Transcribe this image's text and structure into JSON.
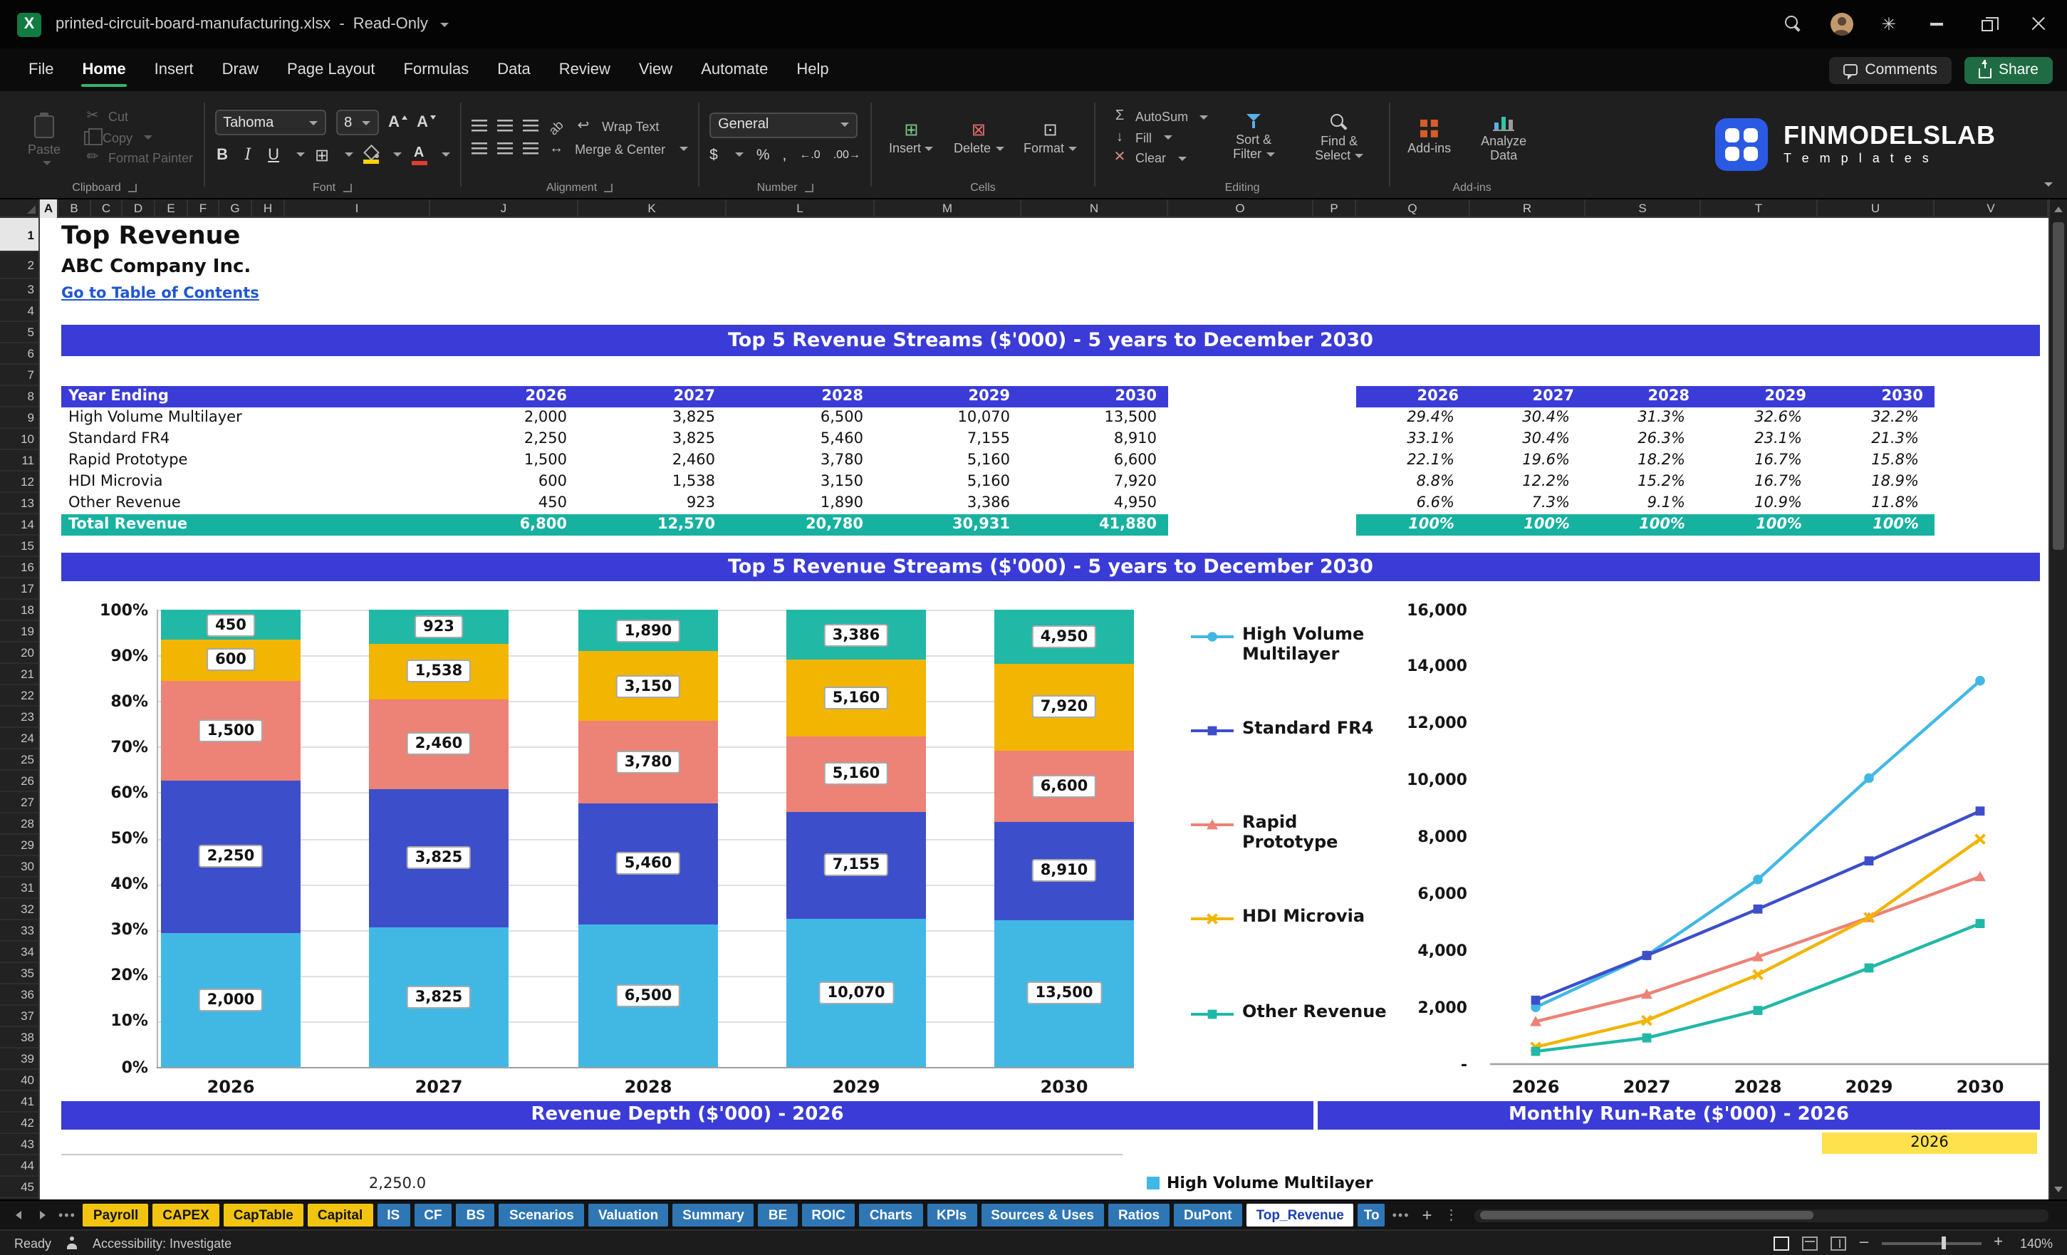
{
  "app": {
    "title": "printed-circuit-board-manufacturing.xlsx",
    "mode": "Read-Only"
  },
  "menubar": {
    "tabs": [
      "File",
      "Home",
      "Insert",
      "Draw",
      "Page Layout",
      "Formulas",
      "Data",
      "Review",
      "View",
      "Automate",
      "Help"
    ],
    "active_tab": "Home",
    "comments_label": "Comments",
    "share_label": "Share"
  },
  "ribbon": {
    "clipboard": {
      "group": "Clipboard",
      "paste": "Paste",
      "cut": "Cut",
      "copy": "Copy",
      "format_painter": "Format Painter"
    },
    "font": {
      "group": "Font",
      "font_name": "Tahoma",
      "font_size": "8"
    },
    "alignment": {
      "group": "Alignment",
      "wrap_text": "Wrap Text",
      "merge_center": "Merge & Center"
    },
    "number": {
      "group": "Number",
      "format": "General"
    },
    "cells": {
      "group": "Cells",
      "insert": "Insert",
      "delete": "Delete",
      "format": "Format"
    },
    "editing": {
      "group": "Editing",
      "autosum": "AutoSum",
      "fill": "Fill",
      "clear": "Clear",
      "sort_filter": "Sort & Filter",
      "find_select": "Find & Select"
    },
    "addins": {
      "group": "Add-ins",
      "button": "Add-ins",
      "analyze_data": "Analyze Data"
    },
    "brand": {
      "name": "FINMODELSLAB",
      "tagline": "T e m p l a t e s"
    }
  },
  "grid": {
    "columns": [
      "A",
      "B",
      "C",
      "D",
      "E",
      "F",
      "G",
      "H",
      "I",
      "J",
      "K",
      "L",
      "M",
      "N",
      "O",
      "P",
      "Q",
      "R",
      "S",
      "T",
      "U",
      "V"
    ],
    "row_count": 45
  },
  "sheet": {
    "title": "Top Revenue",
    "company": "ABC Company Inc.",
    "toc_link": "Go to Table of Contents",
    "section1_title": "Top 5 Revenue Streams ($'000) - 5 years to December 2030",
    "section2_title": "Top 5 Revenue Streams ($'000) - 5 years to December 2030",
    "section3_title": "Revenue Depth ($'000) - 2026",
    "section4_title": "Monthly Run-Rate ($'000) - 2026",
    "table": {
      "row_header": "Year Ending",
      "years": [
        "2026",
        "2027",
        "2028",
        "2029",
        "2030"
      ],
      "rows": [
        {
          "name": "High Volume Multilayer",
          "values": [
            "2,000",
            "3,825",
            "6,500",
            "10,070",
            "13,500"
          ],
          "shares": [
            "29.4%",
            "30.4%",
            "31.3%",
            "32.6%",
            "32.2%"
          ]
        },
        {
          "name": "Standard FR4",
          "values": [
            "2,250",
            "3,825",
            "5,460",
            "7,155",
            "8,910"
          ],
          "shares": [
            "33.1%",
            "30.4%",
            "26.3%",
            "23.1%",
            "21.3%"
          ]
        },
        {
          "name": "Rapid Prototype",
          "values": [
            "1,500",
            "2,460",
            "3,780",
            "5,160",
            "6,600"
          ],
          "shares": [
            "22.1%",
            "19.6%",
            "18.2%",
            "16.7%",
            "15.8%"
          ]
        },
        {
          "name": "HDI Microvia",
          "values": [
            "600",
            "1,538",
            "3,150",
            "5,160",
            "7,920"
          ],
          "shares": [
            "8.8%",
            "12.2%",
            "15.2%",
            "16.7%",
            "18.9%"
          ]
        },
        {
          "name": "Other Revenue",
          "values": [
            "450",
            "923",
            "1,890",
            "3,386",
            "4,950"
          ],
          "shares": [
            "6.6%",
            "7.3%",
            "9.1%",
            "10.9%",
            "11.8%"
          ]
        }
      ],
      "total": {
        "name": "Total Revenue",
        "values": [
          "6,800",
          "12,570",
          "20,780",
          "30,931",
          "41,880"
        ],
        "shares": [
          "100%",
          "100%",
          "100%",
          "100%",
          "100%"
        ]
      }
    },
    "run_rate_year_cell": "2026",
    "depth_first_label": "2,250.0",
    "run_rate_legend": "High Volume Multilayer"
  },
  "chart_data": [
    {
      "type": "bar",
      "subtype": "percent-stacked",
      "title": "Top 5 Revenue Streams ($'000) - 5 years to December 2030",
      "categories": [
        "2026",
        "2027",
        "2028",
        "2029",
        "2030"
      ],
      "series": [
        {
          "name": "High Volume Multilayer",
          "color": "#41b8e4",
          "marker": "circle",
          "values": [
            2000,
            3825,
            6500,
            10070,
            13500
          ],
          "labels": [
            "2,000",
            "3,825",
            "6,500",
            "10,070",
            "13,500"
          ]
        },
        {
          "name": "Standard FR4",
          "color": "#3d4ecb",
          "marker": "square",
          "values": [
            2250,
            3825,
            5460,
            7155,
            8910
          ],
          "labels": [
            "2,250",
            "3,825",
            "5,460",
            "7,155",
            "8,910"
          ]
        },
        {
          "name": "Rapid Prototype",
          "color": "#ed8277",
          "marker": "triangle",
          "values": [
            1500,
            2460,
            3780,
            5160,
            6600
          ],
          "labels": [
            "1,500",
            "2,460",
            "3,780",
            "5,160",
            "6,600"
          ]
        },
        {
          "name": "HDI Microvia",
          "color": "#f1b502",
          "marker": "x",
          "values": [
            600,
            1538,
            3150,
            5160,
            7920
          ],
          "labels": [
            "600",
            "1,538",
            "3,150",
            "5,160",
            "7,920"
          ]
        },
        {
          "name": "Other Revenue",
          "color": "#21b8a6",
          "marker": "square",
          "values": [
            450,
            923,
            1890,
            3386,
            4950
          ],
          "labels": [
            "450",
            "923",
            "1,890",
            "3,386",
            "4,950"
          ]
        }
      ],
      "y_axis_labels": [
        "100%",
        "90%",
        "80%",
        "70%",
        "60%",
        "50%",
        "40%",
        "30%",
        "20%",
        "10%",
        "0%"
      ],
      "grid": true
    },
    {
      "type": "line",
      "x": [
        "2026",
        "2027",
        "2028",
        "2029",
        "2030"
      ],
      "ylim": [
        0,
        16000
      ],
      "y_tick_labels": [
        "16,000",
        "14,000",
        "12,000",
        "10,000",
        "8,000",
        "6,000",
        "4,000",
        "2,000",
        "-"
      ],
      "legend_position": "left",
      "series": [
        {
          "name": "High Volume Multilayer",
          "color": "#41b8e4",
          "marker": "circle",
          "values": [
            2000,
            3825,
            6500,
            10070,
            13500
          ]
        },
        {
          "name": "Standard FR4",
          "color": "#3d4ecb",
          "marker": "square",
          "values": [
            2250,
            3825,
            5460,
            7155,
            8910
          ]
        },
        {
          "name": "Rapid Prototype",
          "color": "#ed8277",
          "marker": "triangle",
          "values": [
            1500,
            2460,
            3780,
            5160,
            6600
          ]
        },
        {
          "name": "HDI Microvia",
          "color": "#f1b502",
          "marker": "x",
          "values": [
            600,
            1538,
            3150,
            5160,
            7920
          ]
        },
        {
          "name": "Other Revenue",
          "color": "#21b8a6",
          "marker": "square",
          "values": [
            450,
            923,
            1890,
            3386,
            4950
          ]
        }
      ]
    }
  ],
  "sheet_tabs": {
    "tabs": [
      {
        "label": "Payroll",
        "style": "yellow"
      },
      {
        "label": "CAPEX",
        "style": "yellow"
      },
      {
        "label": "CapTable",
        "style": "yellow"
      },
      {
        "label": "Capital",
        "style": "yellow"
      },
      {
        "label": "IS",
        "style": "blue"
      },
      {
        "label": "CF",
        "style": "blue"
      },
      {
        "label": "BS",
        "style": "blue"
      },
      {
        "label": "Scenarios",
        "style": "blue"
      },
      {
        "label": "Valuation",
        "style": "blue"
      },
      {
        "label": "Summary",
        "style": "blue"
      },
      {
        "label": "BE",
        "style": "blue"
      },
      {
        "label": "ROIC",
        "style": "blue"
      },
      {
        "label": "Charts",
        "style": "blue"
      },
      {
        "label": "KPIs",
        "style": "blue"
      },
      {
        "label": "Sources & Uses",
        "style": "blue"
      },
      {
        "label": "Ratios",
        "style": "blue"
      },
      {
        "label": "DuPont",
        "style": "blue"
      },
      {
        "label": "Top_Revenue",
        "style": "active"
      },
      {
        "label": "To",
        "style": "blue-partial"
      }
    ]
  },
  "statusbar": {
    "ready": "Ready",
    "accessibility": "Accessibility: Investigate",
    "zoom": "140%"
  }
}
